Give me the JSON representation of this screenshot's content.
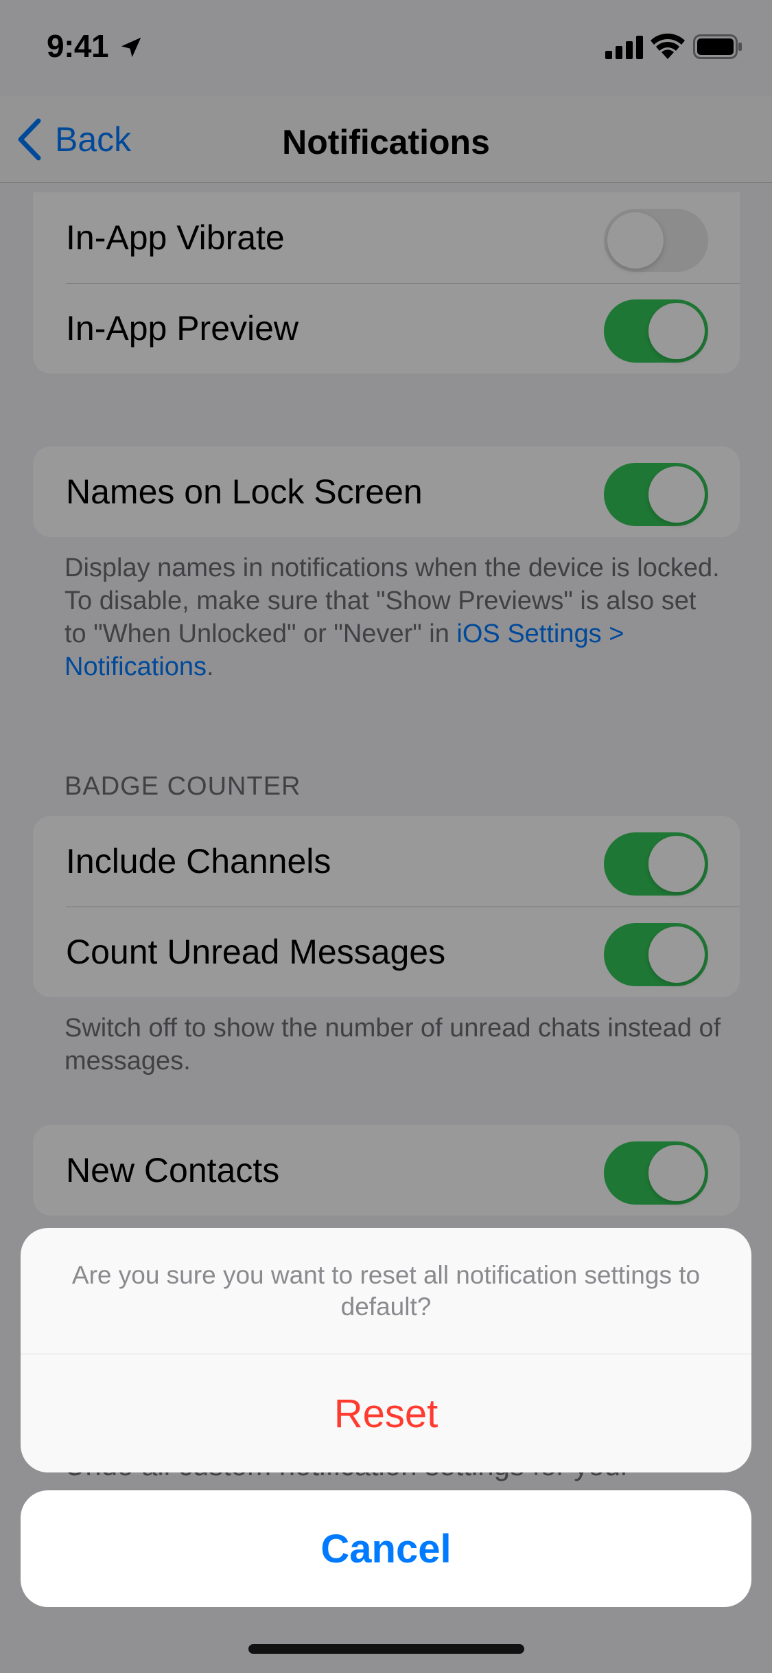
{
  "status_bar": {
    "time": "9:41"
  },
  "nav": {
    "back_label": "Back",
    "title": "Notifications"
  },
  "in_app_group": {
    "items": [
      {
        "label": "In-App Vibrate",
        "on": false
      },
      {
        "label": "In-App Preview",
        "on": true
      }
    ]
  },
  "lock_screen": {
    "label": "Names on Lock Screen",
    "on": true,
    "footer_text": "Display names in notifications when the device is locked. To disable, make sure that \"Show Previews\" is also set to \"When Unlocked\" or \"Never\" in ",
    "footer_link": "iOS Settings > Notifications",
    "footer_end": "."
  },
  "badge_counter": {
    "header": "BADGE COUNTER",
    "items": [
      {
        "label": "Include Channels",
        "on": true
      },
      {
        "label": "Count Unread Messages",
        "on": true
      }
    ],
    "footer": "Switch off to show the number of unread chats instead of messages."
  },
  "contacts": {
    "label": "New Contacts",
    "on": true
  },
  "obscured_footer": "Undo all custom notification settings for your",
  "action_sheet": {
    "message": "Are you sure you want to reset all notification settings to default?",
    "reset_label": "Reset",
    "cancel_label": "Cancel"
  },
  "colors": {
    "toggle_on": "#34c759",
    "link": "#007aff",
    "destructive": "#ff3b30"
  }
}
